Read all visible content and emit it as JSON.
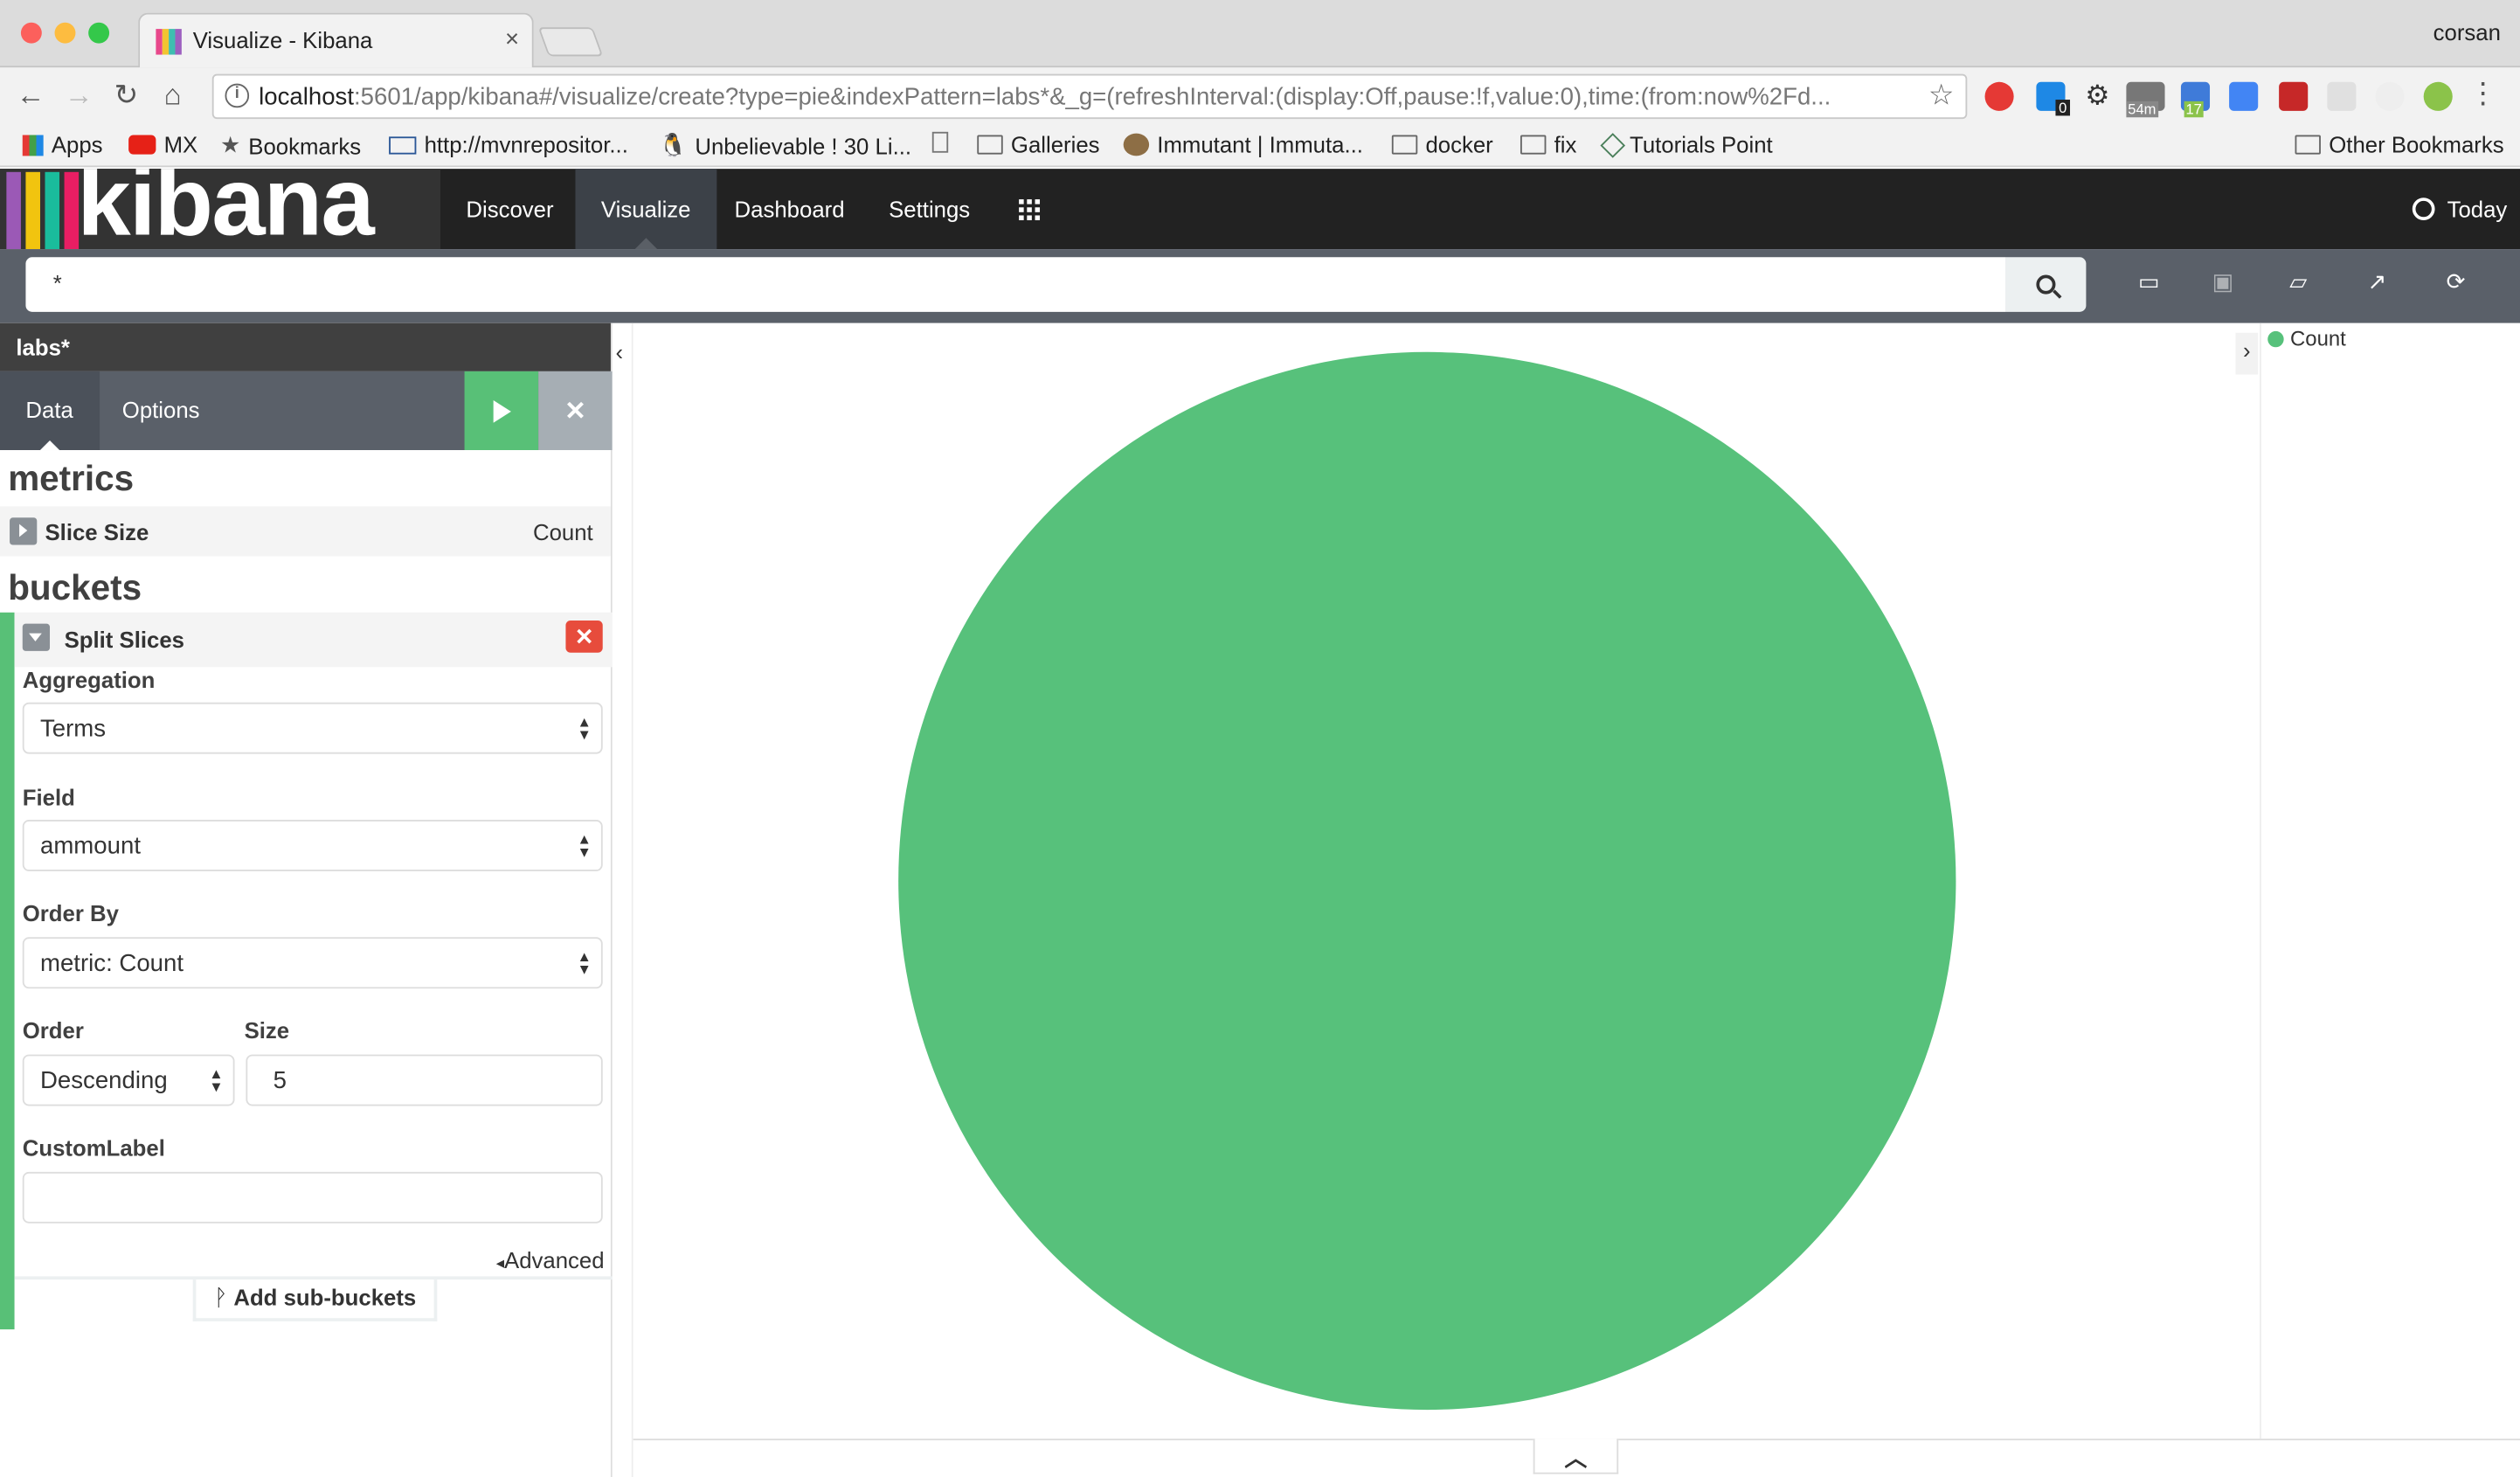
{
  "browser": {
    "tab_title": "Visualize - Kibana",
    "tab_close": "×",
    "profile_name": "corsan",
    "url_host": "localhost",
    "url_rest": ":5601/app/kibana#/visualize/create?type=pie&indexPattern=labs*&_g=(refreshInterval:(display:Off,pause:!f,value:0),time:(from:now%2Fd...",
    "bookmarks": [
      {
        "label": "Apps",
        "icon": "apps-grid-icon"
      },
      {
        "label": "MX",
        "icon": "youtube-icon"
      },
      {
        "label": "Bookmarks",
        "icon": "star-icon"
      },
      {
        "label": "http://mvnrepositor...",
        "icon": "mvn-icon"
      },
      {
        "label": "Unbelievable ! 30 Li...",
        "icon": "penguin-icon"
      },
      {
        "label": "",
        "icon": "page-icon"
      },
      {
        "label": "Galleries",
        "icon": "folder-icon"
      },
      {
        "label": "Immutant | Immuta...",
        "icon": "immutant-icon"
      },
      {
        "label": "docker",
        "icon": "folder-icon"
      },
      {
        "label": "fix",
        "icon": "folder-icon"
      },
      {
        "label": "Tutorials Point",
        "icon": "tutorialspoint-icon"
      }
    ],
    "other_bookmarks": "Other Bookmarks",
    "extension_badges": {
      "clock_badge": "54m",
      "calendar_badge": "17",
      "counter_badge": "0"
    }
  },
  "kibana": {
    "logo_text": "kibana",
    "nav": {
      "discover": "Discover",
      "visualize": "Visualize",
      "dashboard": "Dashboard",
      "settings": "Settings"
    },
    "timepicker": "Today",
    "query": "*"
  },
  "sidebar": {
    "index_pattern": "labs*",
    "tabs": {
      "data": "Data",
      "options": "Options"
    },
    "metrics_heading": "metrics",
    "metric": {
      "label": "Slice Size",
      "value": "Count"
    },
    "buckets_heading": "buckets",
    "bucket": {
      "title": "Split Slices",
      "aggregation_label": "Aggregation",
      "aggregation_value": "Terms",
      "field_label": "Field",
      "field_value": "ammount",
      "order_by_label": "Order By",
      "order_by_value": "metric: Count",
      "order_label": "Order",
      "order_value": "Descending",
      "size_label": "Size",
      "size_value": "5",
      "custom_label_label": "CustomLabel",
      "custom_label_value": ""
    },
    "advanced": "Advanced",
    "add_sub_buckets": "Add sub-buckets"
  },
  "chart_data": {
    "type": "pie",
    "categories": [
      "Count"
    ],
    "values": [
      1
    ],
    "colors": [
      "#57c17b"
    ],
    "legend": [
      "Count"
    ],
    "legend_position": "right"
  },
  "colors": {
    "accent_green": "#58c077",
    "slice": "#57c17b",
    "danger": "#e74c3c"
  }
}
